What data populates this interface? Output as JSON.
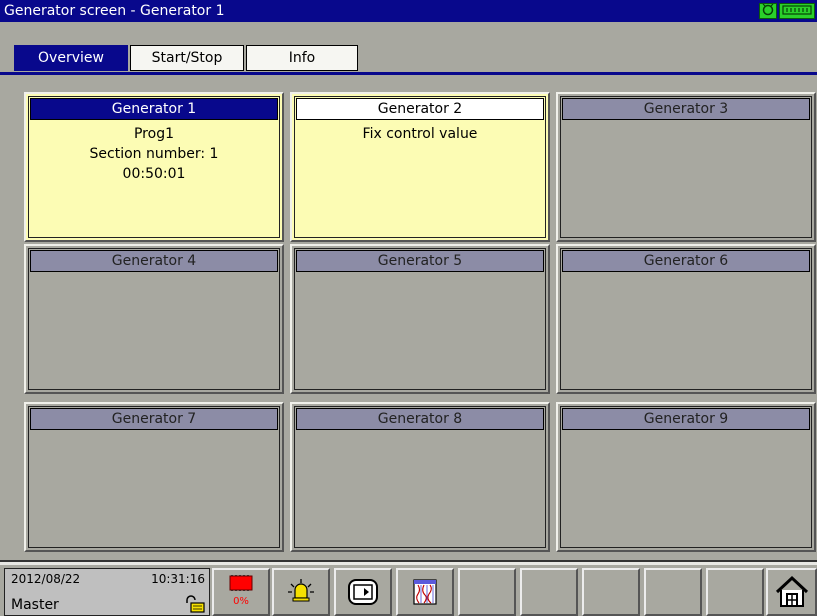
{
  "window": {
    "title": "Generator screen - Generator 1"
  },
  "status_icons": [
    "connection-icon",
    "memory-icon"
  ],
  "tabs": [
    {
      "label": "Overview",
      "active": true
    },
    {
      "label": "Start/Stop",
      "active": false
    },
    {
      "label": "Info",
      "active": false
    }
  ],
  "generators": [
    {
      "name": "Generator 1",
      "state": "active",
      "lines": [
        "Prog1",
        "Section number: 1",
        "00:50:01"
      ]
    },
    {
      "name": "Generator 2",
      "state": "fixed",
      "lines": [
        "Fix control value"
      ]
    },
    {
      "name": "Generator 3",
      "state": "idle",
      "lines": []
    },
    {
      "name": "Generator 4",
      "state": "idle",
      "lines": []
    },
    {
      "name": "Generator 5",
      "state": "idle",
      "lines": []
    },
    {
      "name": "Generator 6",
      "state": "idle",
      "lines": []
    },
    {
      "name": "Generator 7",
      "state": "idle",
      "lines": []
    },
    {
      "name": "Generator 8",
      "state": "idle",
      "lines": []
    },
    {
      "name": "Generator 9",
      "state": "idle",
      "lines": []
    }
  ],
  "status": {
    "date": "2012/08/22",
    "time": "10:31:16",
    "user": "Master",
    "memory_label": "0%",
    "memory_percent": 0
  },
  "toolbar": {
    "buttons": [
      "memory-status-icon",
      "alarm-icon",
      "display-switch-icon",
      "trend-icon",
      "",
      "",
      "",
      "",
      "",
      "home-icon"
    ]
  },
  "colors": {
    "title_bg": "#08088c",
    "active_cell": "#fcfcb4",
    "idle_header": "#8c8ca6",
    "panel_bg": "#a8a8a0"
  }
}
